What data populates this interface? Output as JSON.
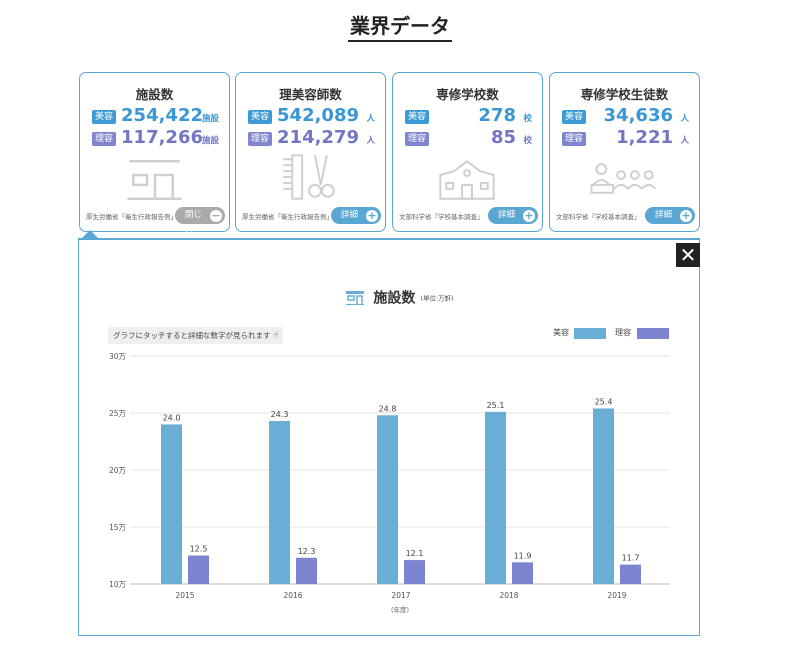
{
  "page_title": "業界データ",
  "cards": [
    {
      "title": "施設数",
      "rows": [
        {
          "badge": "美容",
          "value": "254,422",
          "unit": "施設"
        },
        {
          "badge": "理容",
          "value": "117,266",
          "unit": "施設"
        }
      ],
      "icon": "salon-building-icon",
      "source": "厚生労働省「衛生行政報告例」",
      "button": "閉じる",
      "button_icon": "minus-circle-icon"
    },
    {
      "title": "理美容師数",
      "rows": [
        {
          "badge": "美容",
          "value": "542,089",
          "unit": "人"
        },
        {
          "badge": "理容",
          "value": "214,279",
          "unit": "人"
        }
      ],
      "icon": "comb-scissors-icon",
      "source": "厚生労働省「衛生行政報告例」",
      "button": "詳細",
      "button_icon": "plus-circle-icon"
    },
    {
      "title": "専修学校数",
      "rows": [
        {
          "badge": "美容",
          "value": "278",
          "unit": "校"
        },
        {
          "badge": "理容",
          "value": "85",
          "unit": "校"
        }
      ],
      "icon": "school-building-icon",
      "source": "文部科学省「学校基本調査」",
      "button": "詳細",
      "button_icon": "plus-circle-icon"
    },
    {
      "title": "専修学校生徒数",
      "rows": [
        {
          "badge": "美容",
          "value": "34,636",
          "unit": "人"
        },
        {
          "badge": "理容",
          "value": "1,221",
          "unit": "人"
        }
      ],
      "icon": "students-icon",
      "source": "文部科学省「学校基本調査」",
      "button": "詳細",
      "button_icon": "plus-circle-icon"
    }
  ],
  "panel": {
    "close_icon": "close-icon",
    "chart_title": "施設数",
    "chart_unit": "(単位:万軒)",
    "hint": "グラフにタッチすると詳細な数字が見られます",
    "hint_icon": "hand-pointer-icon"
  },
  "colors": {
    "accent": "#5ba7d4",
    "biyo": "#6aaed6",
    "riyo": "#7c84cf"
  },
  "chart_data": {
    "type": "bar",
    "categories": [
      "2015",
      "2016",
      "2017",
      "2018",
      "2019"
    ],
    "series": [
      {
        "name": "美容",
        "values": [
          24.0,
          24.3,
          24.8,
          25.1,
          25.4
        ],
        "labels": [
          "24.0",
          "24.3",
          "24.8",
          "25.1",
          "25.4"
        ]
      },
      {
        "name": "理容",
        "values": [
          12.5,
          12.3,
          12.1,
          11.9,
          11.7
        ],
        "labels": [
          "12.5",
          "12.3",
          "12.1",
          "11.9",
          "11.7"
        ]
      }
    ],
    "yticks": [
      10,
      15,
      20,
      25,
      30
    ],
    "ytick_labels": [
      "10万",
      "15万",
      "20万",
      "25万",
      "30万"
    ],
    "ylim": [
      10,
      30
    ],
    "xlabel": "(年度)",
    "legend_position": "top-right",
    "grid": true
  }
}
